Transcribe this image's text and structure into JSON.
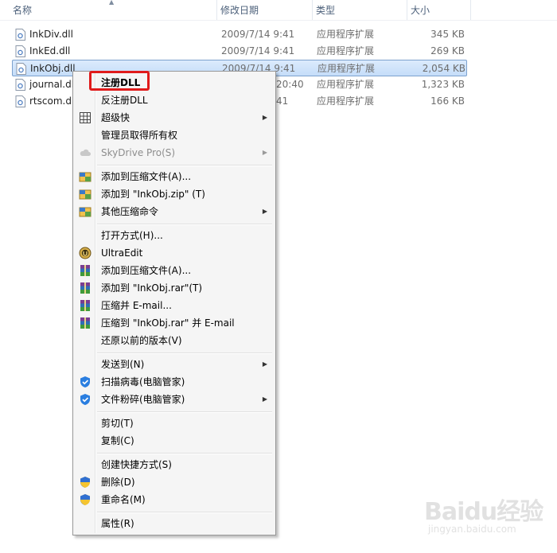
{
  "columns": {
    "name": "名称",
    "date": "修改日期",
    "type": "类型",
    "size": "大小"
  },
  "files": [
    {
      "name": "InkDiv.dll",
      "date": "2009/7/14 9:41",
      "type": "应用程序扩展",
      "size": "345 KB"
    },
    {
      "name": "InkEd.dll",
      "date": "2009/7/14 9:41",
      "type": "应用程序扩展",
      "size": "269 KB"
    },
    {
      "name": "InkObj.dll",
      "date": "2009/7/14 9:41",
      "type": "应用程序扩展",
      "size": "2,054 KB"
    },
    {
      "name": "journal.dl",
      "date": "20:40",
      "type": "应用程序扩展",
      "size": "1,323 KB"
    },
    {
      "name": "rtscom.dl",
      "date": "41",
      "type": "应用程序扩展",
      "size": "166 KB"
    }
  ],
  "menu": {
    "register_dll": "注册DLL",
    "unregister_dll": "反注册DLL",
    "superclip": "超级快",
    "take_ownership": "管理员取得所有权",
    "skydrive": "SkyDrive Pro(S)",
    "add_archive_1": "添加到压缩文件(A)...",
    "add_zip": "添加到 \"InkObj.zip\" (T)",
    "other_compress": "其他压缩命令",
    "open_with": "打开方式(H)...",
    "ultraedit": "UltraEdit",
    "add_archive_2": "添加到压缩文件(A)...",
    "add_rar": "添加到 \"InkObj.rar\"(T)",
    "compress_email": "压缩并 E-mail...",
    "compress_rar_email": "压缩到 \"InkObj.rar\" 并 E-mail",
    "restore_prev": "还原以前的版本(V)",
    "send_to": "发送到(N)",
    "scan_virus": "扫描病毒(电脑管家)",
    "shred_file": "文件粉碎(电脑管家)",
    "cut": "剪切(T)",
    "copy": "复制(C)",
    "create_shortcut": "创建快捷方式(S)",
    "delete": "删除(D)",
    "rename": "重命名(M)",
    "properties": "属性(R)"
  },
  "watermark": {
    "logo": "Baidu经验",
    "url": "jingyan.baidu.com"
  },
  "colors": {
    "selection": "#cde2fb",
    "highlight_box": "#e01b1b",
    "menu_bg": "#f5f5f5"
  }
}
